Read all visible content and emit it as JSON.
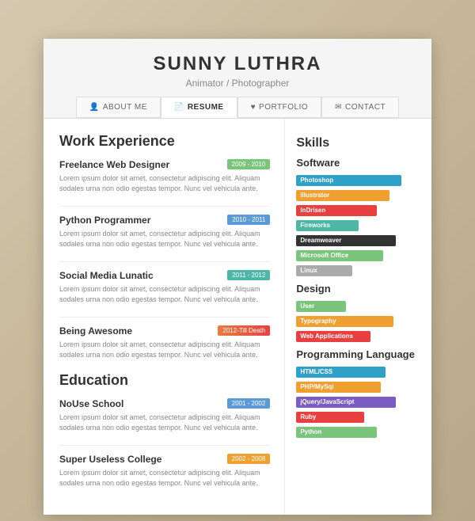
{
  "header": {
    "name": "SUNNY LUTHRA",
    "title": "Animator / Photographer"
  },
  "nav": {
    "tabs": [
      {
        "label": "ABOUT ME",
        "icon": "👤",
        "active": false
      },
      {
        "label": "RESUME",
        "icon": "📄",
        "active": true
      },
      {
        "label": "PORTFOLIO",
        "icon": "♥",
        "active": false
      },
      {
        "label": "CONTACT",
        "icon": "✉",
        "active": false
      }
    ]
  },
  "work_experience": {
    "section_title": "Work Experience",
    "jobs": [
      {
        "title": "Freelance Web Designer",
        "date": "2009 - 2010",
        "date_class": "green",
        "desc": "Lorem ipsum dolor sit amet, consectetur adipiscing elit. Aliquam sodales urna non odio egestas tempor. Nunc vel vehicula ante."
      },
      {
        "title": "Python Programmer",
        "date": "2010 - 2011",
        "date_class": "blue",
        "desc": "Lorem ipsum dolor sit amet, consectetur adipiscing elit. Aliquam sodales urna non odio egestas tempor. Nunc vel vehicula ante."
      },
      {
        "title": "Social Media Lunatic",
        "date": "2011 - 2012",
        "date_class": "teal",
        "desc": "Lorem ipsum dolor sit amet, consectetur adipiscing elit. Aliquam sodales urna non odio egestas tempor. Nunc vel vehicula ante."
      },
      {
        "title": "Being Awesome",
        "date": "2012-Till Death",
        "date_class": "orange-red",
        "desc": "Lorem ipsum dolor sit amet, consectetur adipiscing elit. Aliquam sodales urna non odio egestas tempor. Nunc vel vehicula ante."
      }
    ]
  },
  "education": {
    "section_title": "Education",
    "schools": [
      {
        "name": "NoUse School",
        "date": "2001 - 2002",
        "date_class": "edu-blue",
        "desc": "Lorem ipsum dolor sit amet, consectetur adipiscing elit. Aliquam sodales urna non odio egestas tempor. Nunc vel vehicula ante."
      },
      {
        "name": "Super Useless College",
        "date": "2002 - 2008",
        "date_class": "edu-orange",
        "desc": "Lorem ipsum dolor sit amet, consectetur adipiscing elit. Aliquam sodales urna non odio egestas tempor. Nunc vel vehicula ante."
      }
    ]
  },
  "skills": {
    "software": {
      "title": "Software",
      "items": [
        {
          "name": "Photoshop",
          "bar_class": "bar-photoshop"
        },
        {
          "name": "Illustrator",
          "bar_class": "bar-illustrator"
        },
        {
          "name": "InDrisen",
          "bar_class": "bar-indesign"
        },
        {
          "name": "Fireworks",
          "bar_class": "bar-fireworks"
        },
        {
          "name": "Dreamweaver",
          "bar_class": "bar-dreamweaver"
        },
        {
          "name": "Microsoft Office",
          "bar_class": "bar-msoffice"
        },
        {
          "name": "Linux",
          "bar_class": "bar-linux"
        }
      ]
    },
    "design": {
      "title": "Design",
      "items": [
        {
          "name": "User",
          "bar_class": "bar-user"
        },
        {
          "name": "Typography",
          "bar_class": "bar-typography"
        },
        {
          "name": "Web Applications",
          "bar_class": "bar-webapps"
        }
      ]
    },
    "programming": {
      "title": "Programming Language",
      "items": [
        {
          "name": "HTML/CSS",
          "bar_class": "bar-htmlcss"
        },
        {
          "name": "PHP/MySql",
          "bar_class": "bar-phpmysql"
        },
        {
          "name": "jQuery/JavaScript",
          "bar_class": "bar-jquery"
        },
        {
          "name": "Ruby",
          "bar_class": "bar-ruby"
        },
        {
          "name": "Python",
          "bar_class": "bar-python"
        }
      ]
    }
  }
}
